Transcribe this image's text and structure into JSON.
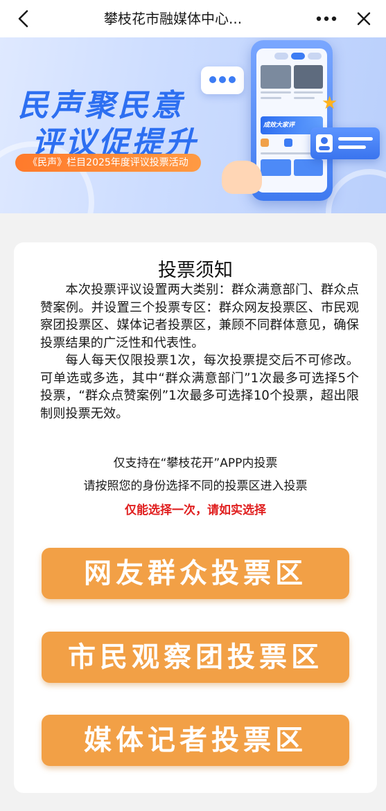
{
  "header": {
    "title": "攀枝花市融媒体中心...",
    "back_icon": "chevron-left-icon",
    "more_icon": "more-dots-icon",
    "close_icon": "close-icon"
  },
  "banner": {
    "headline_line1": "民声聚民意",
    "headline_line2": "评议促提升",
    "subtitle": "《民声》栏目2025年度评议投票活动",
    "accent_color": "#2d6ff1",
    "pill_color": "#ff7a2b"
  },
  "notice": {
    "title": "投票须知",
    "paragraph1": "本次投票评议设置两大类别：群众满意部门、群众点赞案例。并设置三个投票专区：群众网友投票区、市民观察团投票区、媒体记者投票区，兼顾不同群体意见，确保投票结果的广泛性和代表性。",
    "paragraph2": "每人每天仅限投票1次，每次投票提交后不可修改。可单选或多选，其中“群众满意部门”1次最多可选择5个投票，“群众点赞案例”1次最多可选择10个投票，超出限制则投票无效。",
    "app_only": "仅支持在“攀枝花开”APP内投票",
    "choose_zone": "请按照您的身份选择不同的投票区进入投票",
    "warning": "仅能选择一次，请如实选择",
    "warning_color": "#e02020"
  },
  "vote_buttons": [
    {
      "label": "网友群众投票区"
    },
    {
      "label": "市民观察团投票区"
    },
    {
      "label": "媒体记者投票区"
    }
  ],
  "button_color": "#f2a046"
}
